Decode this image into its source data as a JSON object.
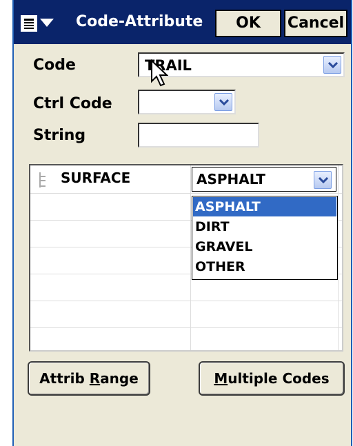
{
  "title": "Code-Attribute",
  "buttons": {
    "ok": "OK",
    "cancel": "Cancel"
  },
  "form": {
    "code_label": "Code",
    "code_value": "TRAIL",
    "ctrl_code_label": "Ctrl Code",
    "ctrl_code_value": "",
    "string_label": "String",
    "string_value": ""
  },
  "grid": {
    "attribute_name": "SURFACE",
    "attribute_value": "ASPHALT",
    "options": [
      "ASPHALT",
      "DIRT",
      "GRAVEL",
      "OTHER"
    ],
    "selected_option": "ASPHALT"
  },
  "bottom": {
    "attrib_range_pre": "Attrib ",
    "attrib_range_key": "R",
    "attrib_range_post": "ange",
    "multiple_codes_key": "M",
    "multiple_codes_post": "ultiple Codes"
  },
  "colors": {
    "titlebar": "#0a246a",
    "dialog_bg": "#ece9d8",
    "selection": "#316ac5"
  },
  "icons": [
    "menu-icon",
    "chevron-down-icon",
    "tree-connector-icon",
    "mouse-pointer-icon"
  ]
}
